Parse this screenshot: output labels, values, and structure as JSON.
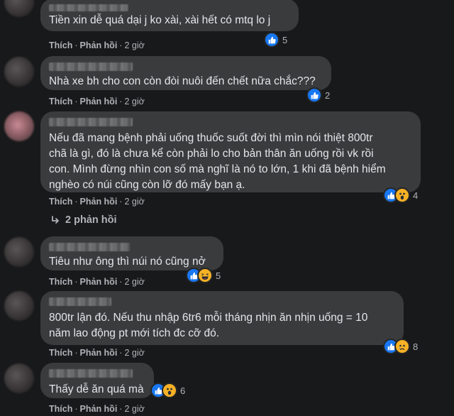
{
  "comments": [
    {
      "text": "Tiền xin dễ quá dại j ko xài, xài hết có mtq lo j",
      "like": "Thích",
      "reply": "Phản hồi",
      "time": "2 giờ",
      "reaction_count": "5",
      "reactions": [
        "like"
      ]
    },
    {
      "text": "Nhà xe bh cho con còn đòi nuôi đến chết nữa chắc???",
      "like": "Thích",
      "reply": "Phản hồi",
      "time": "2 giờ",
      "reaction_count": "2",
      "reactions": [
        "like"
      ]
    },
    {
      "text": "Nếu đã mang bệnh phải uống thuốc suốt đời thì mìn nói thiệt 800tr\nchã là gì, đó là chưa kể còn phải lo cho bản thân ăn uống rồi vk rồi\ncon. Mình đừng nhìn con số mà nghĩ là nó to lớn, 1 khi đã bệnh hiểm\nnghèo có núi cũng còn lỡ đó mấy bạn ạ.",
      "like": "Thích",
      "reply": "Phản hồi",
      "time": "2 giờ",
      "reaction_count": "4",
      "reactions": [
        "like",
        "wow"
      ]
    },
    {
      "text": "Tiêu như ông thì núi nó cũng nở",
      "like": "Thích",
      "reply": "Phản hồi",
      "time": "2 giờ",
      "reaction_count": "5",
      "reactions": [
        "like",
        "haha"
      ]
    },
    {
      "text": "800tr lận đó. Nếu thu nhập 6tr6 mỗi tháng nhịn ăn nhịn uống = 10\nnăm lao động pt mới tích đc cỡ đó.",
      "like": "Thích",
      "reply": "Phản hồi",
      "time": "2 giờ",
      "reaction_count": "8",
      "reactions": [
        "like",
        "sad"
      ]
    },
    {
      "text": "Thấy dễ ăn quá mà",
      "like": "Thích",
      "reply": "Phản hồi",
      "time": "2 giờ",
      "reaction_count": "6",
      "reactions": [
        "like",
        "wow"
      ]
    }
  ],
  "replies_link": "2 phản hồi",
  "separator": "·"
}
